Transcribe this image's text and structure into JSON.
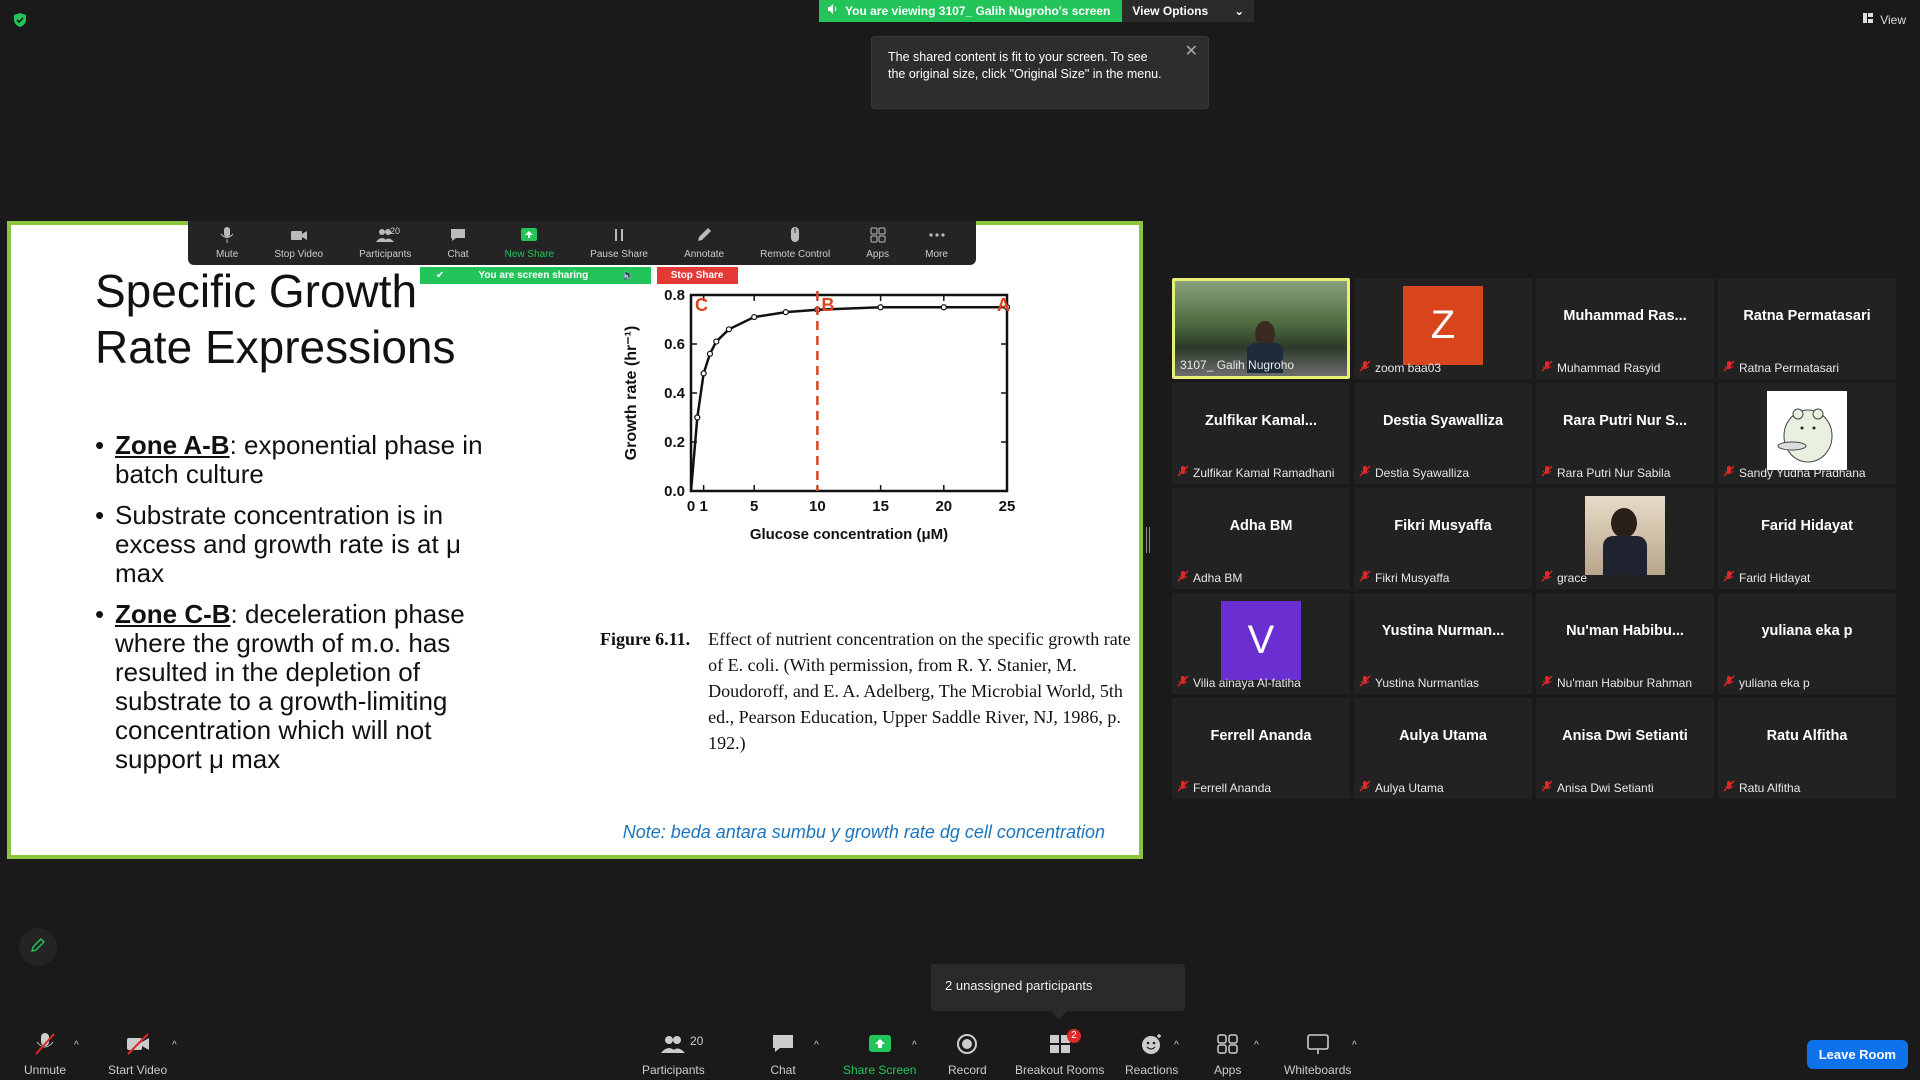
{
  "banner": {
    "viewing_text": "You are viewing 3107_ Galih Nugroho's screen",
    "view_options": "View Options",
    "view_label": "View"
  },
  "tooltip": {
    "text": "The shared content is fit to your screen. To see the original size, click \"Original Size\" in the menu."
  },
  "share_toolbar": {
    "items": [
      {
        "label": "Mute",
        "icon": "mic-icon"
      },
      {
        "label": "Stop Video",
        "icon": "video-icon"
      },
      {
        "label": "Participants",
        "icon": "participants-icon",
        "count": "20"
      },
      {
        "label": "Chat",
        "icon": "chat-icon"
      },
      {
        "label": "New Share",
        "icon": "share-icon"
      },
      {
        "label": "Pause Share",
        "icon": "pause-icon"
      },
      {
        "label": "Annotate",
        "icon": "pen-icon"
      },
      {
        "label": "Remote Control",
        "icon": "mouse-icon"
      },
      {
        "label": "Apps",
        "icon": "apps-icon"
      },
      {
        "label": "More",
        "icon": "more-icon"
      }
    ],
    "sharing_status": "You are screen sharing",
    "stop_share": "Stop Share"
  },
  "slide": {
    "title": "Specific Growth Rate Expressions",
    "bullets": [
      {
        "zone": "Zone A-B",
        "text": ": exponential phase in batch culture"
      },
      {
        "zone": "",
        "text": "Substrate concentration is in excess and growth rate is at μ max"
      },
      {
        "zone": "Zone C-B",
        "text": ": deceleration phase where the growth of m.o. has resulted in the depletion of substrate to a growth-limiting concentration which will not support μ max"
      }
    ],
    "figure_label": "Figure 6.11.",
    "figure_caption": "Effect of nutrient concentration on the specific growth rate of E. coli. (With permission, from R. Y. Stanier, M. Doudoroff, and E. A. Adelberg, The Microbial World, 5th ed., Pearson Education, Upper Saddle River, NJ, 1986, p. 192.)",
    "note": "Note: beda antara sumbu y growth rate dg cell concentration"
  },
  "chart_data": {
    "type": "line",
    "xlabel": "Glucose concentration (μM)",
    "ylabel": "Growth rate (hr⁻¹)",
    "xlim": [
      0,
      25
    ],
    "ylim": [
      0,
      0.8
    ],
    "x_ticks": [
      0,
      1,
      5,
      10,
      15,
      20,
      25
    ],
    "y_ticks": [
      0.0,
      0.2,
      0.4,
      0.6,
      0.8
    ],
    "y_tick_labels": [
      "0.0",
      "0.2",
      "0.4",
      "0.6",
      "0.8"
    ],
    "series": [
      {
        "x": [
          0,
          0.5,
          1,
          1.5,
          2,
          3,
          5,
          7.5,
          10,
          15,
          20,
          25
        ],
        "values": [
          0.0,
          0.3,
          0.48,
          0.56,
          0.61,
          0.66,
          0.71,
          0.73,
          0.74,
          0.75,
          0.75,
          0.75
        ]
      }
    ],
    "asymptote_y": 0.8,
    "zone_line_x": 10,
    "zone_labels": [
      {
        "text": "C",
        "x": 0
      },
      {
        "text": "B",
        "x": 10
      },
      {
        "text": "A",
        "x": 25
      }
    ],
    "grid": false
  },
  "gallery": [
    {
      "display": "",
      "name": "3107_ Galih Nugroho",
      "avatar_type": "video",
      "active": true,
      "muted": false
    },
    {
      "display": "",
      "name": "zoom baa03",
      "avatar_type": "letter",
      "letter": "Z",
      "color": "#d9461e",
      "muted": true
    },
    {
      "display": "Muhammad  Ras...",
      "name": "Muhammad Rasyid",
      "muted": true
    },
    {
      "display": "Ratna Permatasari",
      "name": "Ratna Permatasari",
      "muted": true
    },
    {
      "display": "Zulfikar  Kamal...",
      "name": "Zulfikar Kamal Ramadhani",
      "muted": true
    },
    {
      "display": "Destia Syawalliza",
      "name": "Destia Syawalliza",
      "muted": true
    },
    {
      "display": "Rara Putri Nur S...",
      "name": "Rara Putri Nur Sabila",
      "muted": true
    },
    {
      "display": "",
      "name": "Sandy Yudha Pradhana",
      "avatar_type": "bear",
      "muted": true
    },
    {
      "display": "Adha BM",
      "name": "Adha BM",
      "muted": true
    },
    {
      "display": "Fikri Musyaffa",
      "name": "Fikri Musyaffa",
      "muted": true
    },
    {
      "display": "",
      "name": "grace",
      "avatar_type": "photo",
      "muted": true
    },
    {
      "display": "Farid Hidayat",
      "name": "Farid Hidayat",
      "muted": true
    },
    {
      "display": "",
      "name": "Vilia ainaya Al-fatiha",
      "avatar_type": "letter",
      "letter": "V",
      "color": "#6b2fd1",
      "muted": true
    },
    {
      "display": "Yustina  Nurman...",
      "name": "Yustina Nurmantias",
      "muted": true
    },
    {
      "display": "Nu'man  Habibu...",
      "name": "Nu'man Habibur Rahman",
      "muted": true
    },
    {
      "display": "yuliana eka p",
      "name": "yuliana eka p",
      "muted": true
    },
    {
      "display": "Ferrell Ananda",
      "name": "Ferrell Ananda",
      "muted": true
    },
    {
      "display": "Aulya Utama",
      "name": "Aulya Utama",
      "muted": true
    },
    {
      "display": "Anisa Dwi Setianti",
      "name": "Anisa Dwi Setianti",
      "muted": true
    },
    {
      "display": "Ratu Alfitha",
      "name": "Ratu Alfitha",
      "muted": true
    }
  ],
  "unassigned": "2 unassigned participants",
  "bottom_bar": {
    "unmute": "Unmute",
    "start_video": "Start Video",
    "participants": "Participants",
    "participants_count": "20",
    "chat": "Chat",
    "share_screen": "Share Screen",
    "record": "Record",
    "breakout_rooms": "Breakout Rooms",
    "breakout_badge": "2",
    "reactions": "Reactions",
    "apps": "Apps",
    "whiteboards": "Whiteboards",
    "leave_room": "Leave Room"
  },
  "colors": {
    "accent_green": "#23c55b",
    "slide_border": "#8cc63f",
    "leave_blue": "#0e72ed",
    "stop_red": "#e53935",
    "note_blue": "#1c75bc",
    "zone_red": "#d9461e"
  }
}
